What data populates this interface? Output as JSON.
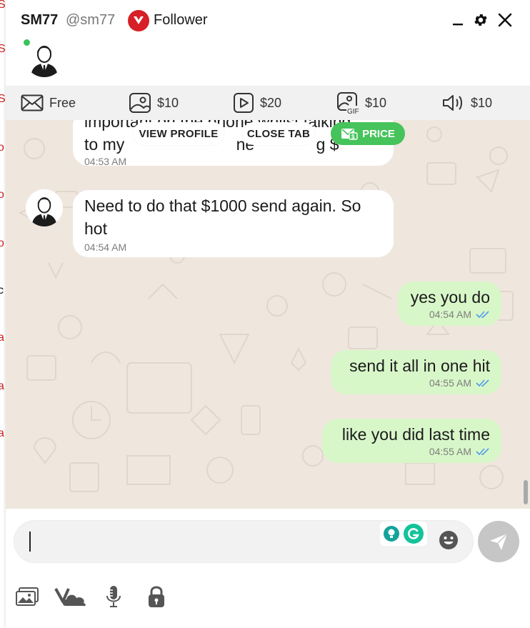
{
  "background_page": {
    "edge_letters": [
      "SI",
      "SI",
      "SI",
      "o",
      "o",
      "o",
      "c",
      "a",
      "a",
      "a"
    ]
  },
  "header": {
    "name": "SM77",
    "handle": "@sm77",
    "follower_label": "Follower",
    "online": true,
    "buttons": [
      "minimize-icon",
      "gear-icon",
      "close-icon"
    ]
  },
  "price_bar": {
    "items": [
      {
        "icon": "envelope-icon",
        "label": "Free"
      },
      {
        "icon": "photo-icon",
        "label": "$10"
      },
      {
        "icon": "video-play-icon",
        "label": "$20"
      },
      {
        "icon": "gif-icon",
        "label": "$10"
      },
      {
        "icon": "speaker-icon",
        "label": "$10"
      }
    ]
  },
  "messages": [
    {
      "direction": "in",
      "text_line1": "important on the phone whilst talking",
      "text_line2": "to my",
      "text_line2_tail_a": "ne",
      "text_line2_tail_b": "g $",
      "time": "04:53 AM",
      "partially_obscured": true
    },
    {
      "direction": "in",
      "text_line1": "Need to do that $1000 send again. So",
      "text_line2": "hot",
      "time": "04:54 AM"
    },
    {
      "direction": "out",
      "text": "yes you do",
      "time": "04:54 AM",
      "read_receipt": "double-check-icon"
    },
    {
      "direction": "out",
      "text": "send it all in one hit",
      "time": "04:55 AM",
      "read_receipt": "double-check-icon"
    },
    {
      "direction": "out",
      "text": "like you did last time",
      "time": "04:55 AM",
      "read_receipt": "double-check-icon"
    }
  ],
  "overlay_buttons": {
    "view_profile": "VIEW PROFILE",
    "close_tab": "CLOSE TAB",
    "price": "PRICE"
  },
  "composer": {
    "value": "",
    "tools": [
      "image-upload-icon",
      "vault-cloud-icon",
      "microphone-icon",
      "lock-icon"
    ]
  },
  "colors": {
    "brand_red": "#d61f26",
    "chat_bg": "#efe7de",
    "outgoing_bubble": "#d8f7c9",
    "incoming_bubble": "#ffffff",
    "price_green": "#46c35a",
    "read_tick": "#4f9be8"
  }
}
